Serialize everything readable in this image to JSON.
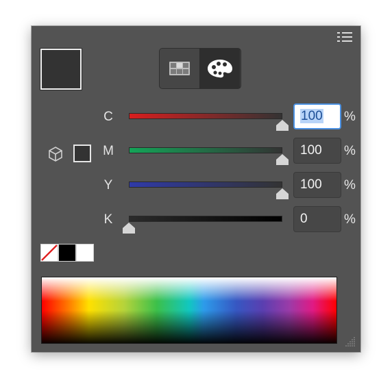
{
  "panel": {
    "menu_icon": "menu-list-icon",
    "fill_color": "#333333",
    "mode_buttons": [
      {
        "name": "swatches-grid-icon",
        "selected": false
      },
      {
        "name": "palette-icon",
        "selected": true
      }
    ]
  },
  "channels": [
    {
      "label": "C",
      "value": "100",
      "percent": 1.0,
      "gradient": [
        "#d81e1e",
        "#333333"
      ],
      "active": true
    },
    {
      "label": "M",
      "value": "100",
      "percent": 1.0,
      "gradient": [
        "#14a458",
        "#333333"
      ],
      "active": false
    },
    {
      "label": "Y",
      "value": "100",
      "percent": 1.0,
      "gradient": [
        "#2f3aa8",
        "#333333"
      ],
      "active": false
    },
    {
      "label": "K",
      "value": "0",
      "percent": 0.0,
      "gradient": [
        "#2b2b2b",
        "#000000"
      ],
      "active": false
    }
  ],
  "percent_sign": "%",
  "icons": {
    "gamut": "cube-gamut-icon",
    "websafe": "websafe-swatch-icon",
    "resize": "resize-grip-icon"
  },
  "quick_swatches": [
    {
      "name": "none-swatch",
      "color": "#ffffff"
    },
    {
      "name": "black-swatch",
      "color": "#000000"
    },
    {
      "name": "white-swatch",
      "color": "#ffffff"
    }
  ],
  "colors": {
    "panel_bg": "#535353",
    "field_bg": "#474747",
    "accent": "#4a90e2",
    "selection": "#b8d4f8"
  }
}
